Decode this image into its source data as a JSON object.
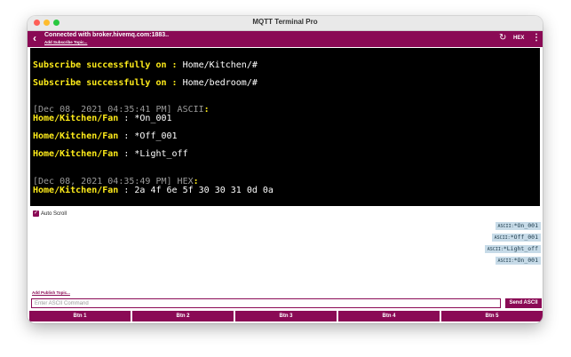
{
  "window": {
    "title": "MQTT Terminal Pro"
  },
  "appbar": {
    "back_icon": "chevron-left-icon",
    "connection_text": "Connected with broker.hivemq.com:1883..",
    "add_subscribe_label": "Add Subscribe Topic...",
    "refresh_icon": "refresh-icon",
    "hex_label": "HEX",
    "menu_icon": "kebab-menu-icon"
  },
  "terminal": {
    "l1_prefix": "Subscribe successfully on : ",
    "l1_topic": "Home/Kitchen/#",
    "l2_prefix": "Subscribe successfully on : ",
    "l2_topic": "Home/bedroom/#",
    "l3_time": "[Dec 08, 2021 04:35:41 PM] ASCII",
    "l3_colon": ":",
    "l4_topic": "Home/Kitchen/Fan",
    "l4_sep": " : ",
    "l4_msg": "*On_001",
    "l5_topic": "Home/Kitchen/Fan",
    "l5_sep": " : ",
    "l5_msg": "*Off_001",
    "l6_topic": "Home/Kitchen/Fan",
    "l6_sep": " : ",
    "l6_msg": "*Light_off",
    "l7_time": "[Dec 08, 2021 04:35:49 PM] HEX",
    "l7_colon": ":",
    "l8_topic": "Home/Kitchen/Fan",
    "l8_sep": " : ",
    "l8_msg": "2a 4f 6e 5f 30 30 31 0d 0a"
  },
  "auto_scroll": {
    "label": "Auto Scroll",
    "checked": true
  },
  "sent_messages": [
    {
      "tag": "ASCII:",
      "msg": "*On_001"
    },
    {
      "tag": "ASCII:",
      "msg": "*Off_001"
    },
    {
      "tag": "ASCII:",
      "msg": "*Light_off"
    },
    {
      "tag": "ASCII:",
      "msg": "*On_001"
    }
  ],
  "publish": {
    "add_publish_label": "Add Publish Topic...",
    "placeholder": "Enter ASCII Command",
    "send_label": "Send ASCII"
  },
  "buttons": [
    "Btn 1",
    "Btn 2",
    "Btn 3",
    "Btn 4",
    "Btn 5"
  ],
  "colors": {
    "accent": "#8a0a55",
    "terminal_bg": "#000000",
    "terminal_highlight": "#ffec1a",
    "sent_bubble": "#c7dbe8"
  }
}
